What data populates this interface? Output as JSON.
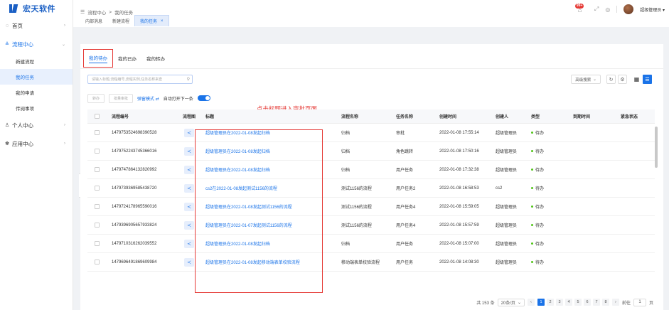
{
  "app": {
    "logo_text": "宏天软件"
  },
  "sidebar": {
    "items": [
      {
        "label": "首页",
        "icon": "home-icon"
      },
      {
        "label": "流程中心",
        "icon": "flow-icon",
        "open": true,
        "children": [
          {
            "label": "新建流程"
          },
          {
            "label": "我的任务",
            "active": true
          },
          {
            "label": "我的申请"
          },
          {
            "label": "传阅事项"
          }
        ]
      },
      {
        "label": "个人中心",
        "icon": "user-icon"
      },
      {
        "label": "应用中心",
        "icon": "app-icon"
      }
    ]
  },
  "header": {
    "breadcrumb": [
      "流程中心",
      "我的任务"
    ],
    "badge_count": "99+",
    "user_name": "超级管理员"
  },
  "tabs": [
    {
      "label": "内部消息"
    },
    {
      "label": "新建流程"
    },
    {
      "label": "我的任务",
      "active": true
    }
  ],
  "subtabs": [
    {
      "label": "我的待办",
      "active": true
    },
    {
      "label": "我的已办"
    },
    {
      "label": "我的转办"
    }
  ],
  "search": {
    "placeholder": "请输入标题,流程编号,流程实例,任务名称来查"
  },
  "toolbar": {
    "advanced_search": "高级搜索"
  },
  "actions": {
    "btn1": "转办",
    "btn2": "批量审批",
    "mode_link": "弹窗模式 ⇄",
    "auto_open": "自动打开下一条"
  },
  "hint": "点击标题进入审批页面",
  "table": {
    "columns": [
      "流程编号",
      "流程图",
      "标题",
      "流程名称",
      "任务名称",
      "创建时间",
      "创建人",
      "类型",
      "到期时间",
      "紧急状态"
    ],
    "rows": [
      {
        "id": "1479753524698390528",
        "title": "超级管理员在2022-01-08发起归档",
        "flow": "归档",
        "task": "审批",
        "time": "2022-01-08 17:55:14",
        "creator": "超级管理员",
        "type": "待办"
      },
      {
        "id": "1479752243745366016",
        "title": "超级管理员在2022-01-08发起归档",
        "flow": "归档",
        "task": "角色跳转",
        "time": "2022-01-08 17:50:16",
        "creator": "超级管理员",
        "type": "待办"
      },
      {
        "id": "1479747864132820992",
        "title": "超级管理员在2022-01-08发起归档",
        "flow": "归档",
        "task": "用户任务",
        "time": "2022-01-08 17:32:38",
        "creator": "超级管理员",
        "type": "待办"
      },
      {
        "id": "1479739369585438720",
        "title": "cs2在2022-01-08发起测试1156的流程",
        "flow": "测试1156的流程",
        "task": "用户任务2",
        "time": "2022-01-08 16:58:53",
        "creator": "cs2",
        "type": "待办"
      },
      {
        "id": "1479724178965590016",
        "title": "超级管理员在2022-01-08发起测试1156的流程",
        "flow": "测试1156的流程",
        "task": "用户任务4",
        "time": "2022-01-08 15:59:05",
        "creator": "超级管理员",
        "type": "待办"
      },
      {
        "id": "1479396905657933824",
        "title": "超级管理员在2022-01-07发起测试1156的流程",
        "flow": "测试1156的流程",
        "task": "用户任务4",
        "time": "2022-01-08 15:57:59",
        "creator": "超级管理员",
        "type": "待办"
      },
      {
        "id": "1479710316262039552",
        "title": "超级管理员在2022-01-08发起归档",
        "flow": "归档",
        "task": "用户任务",
        "time": "2022-01-08 15:07:00",
        "creator": "超级管理员",
        "type": "待办"
      },
      {
        "id": "1479696491869609984",
        "title": "超级管理员在2022-01-08发起移动端表单校验流程",
        "flow": "移动端表单校验流程",
        "task": "用户任务",
        "time": "2022-01-08 14:08:30",
        "creator": "超级管理员",
        "type": "待办"
      }
    ]
  },
  "pagination": {
    "total": "共 153 条",
    "page_size": "20条/页",
    "pages": [
      "1",
      "2",
      "3",
      "4",
      "5",
      "6",
      "7",
      "8"
    ],
    "goto_label": "前往",
    "goto_value": "1",
    "page_unit": "页"
  }
}
